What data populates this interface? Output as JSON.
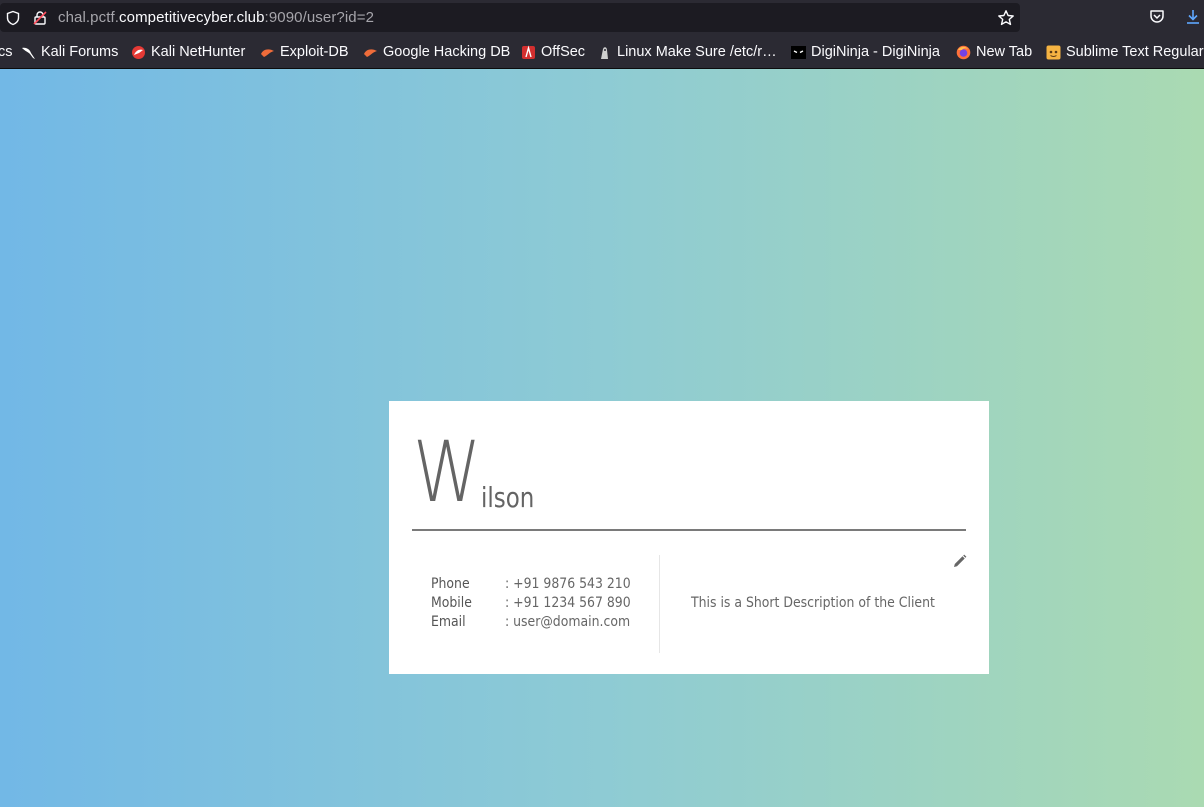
{
  "browser": {
    "url_prefix": "chal.pctf.",
    "url_host": "competitivecyber.club",
    "url_suffix": ":9090/user?id=2",
    "bookmarks": [
      {
        "label": "cs",
        "icon": "none"
      },
      {
        "label": "Kali Forums",
        "icon": "kali-dragon-icon"
      },
      {
        "label": "Kali NetHunter",
        "icon": "nethunter-icon"
      },
      {
        "label": "Exploit-DB",
        "icon": "exploit-db-icon"
      },
      {
        "label": "Google Hacking DB",
        "icon": "ghdb-icon"
      },
      {
        "label": "OffSec",
        "icon": "offsec-icon"
      },
      {
        "label": "Linux Make Sure /etc/r…",
        "icon": "linux-icon"
      },
      {
        "label": "DigiNinja - DigiNinja",
        "icon": "digininja-icon"
      },
      {
        "label": "New Tab",
        "icon": "firefox-icon"
      },
      {
        "label": "Sublime Text Regular",
        "icon": "sublime-icon"
      }
    ]
  },
  "card": {
    "name_initial": "W",
    "name_rest": "ilson",
    "fields": [
      {
        "label": "Phone",
        "value": ": +91 9876 543 210"
      },
      {
        "label": "Mobile",
        "value": ": +91 1234 567 890"
      },
      {
        "label": "Email",
        "value": ": user@domain.com"
      }
    ],
    "description": "This is a Short Description of the Client"
  },
  "colors": {
    "gradient_left": "#72b8e6",
    "gradient_right": "#aadab2",
    "toolbar_bg": "#2b2a33"
  }
}
